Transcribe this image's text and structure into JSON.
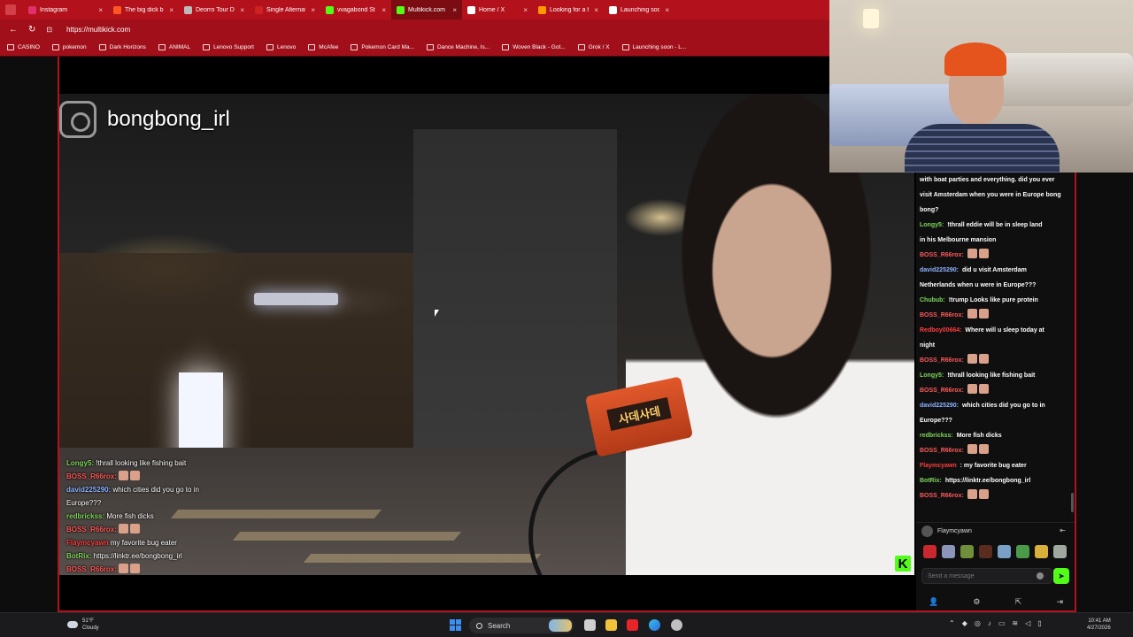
{
  "browser": {
    "tabs": [
      {
        "label": "Instagram",
        "color": "#e1306c",
        "active": false
      },
      {
        "label": "The big dick b",
        "color": "#ff5722",
        "active": false
      },
      {
        "label": "Deorro Tour Dates",
        "color": "#bbbbbb",
        "active": false
      },
      {
        "label": "Single Alternative",
        "color": "#cc2222",
        "active": false
      },
      {
        "label": "vvagabond St",
        "color": "#53fc18",
        "active": false
      },
      {
        "label": "Multikick.com",
        "color": "#53fc18",
        "active": true
      },
      {
        "label": "Home / X",
        "color": "#ffffff",
        "active": false
      },
      {
        "label": "Looking for a hous",
        "color": "#ff9800",
        "active": false
      },
      {
        "label": "Launching soon - L",
        "color": "#ffffff",
        "active": false
      }
    ],
    "url": "https://multikick.com",
    "bookmarks": [
      "CASINO",
      "pokemon",
      "Dark Horizons",
      "ANIMAL",
      "Lenovo Support",
      "Lenovo",
      "McAfee",
      "Pokemon Card Ma...",
      "Dance Machine, Is...",
      "Woven Black - Got...",
      "Grok / X",
      "Launching soon - L..."
    ]
  },
  "stream": {
    "channel_name": "bongbong_irl",
    "can_label": "사데사데",
    "overlay_chat": [
      {
        "user": "Longy5:",
        "user_color": "#7fd65a",
        "text": "!thrall looking like fishing bait"
      },
      {
        "user": "BOSS_R66rox:",
        "user_color": "#ff5a5a",
        "text": ""
      },
      {
        "user": "david225290:",
        "user_color": "#8fb3ff",
        "text": "which cities did you go to in"
      },
      {
        "user": "",
        "user_color": "#ffffff",
        "text": "Europe???"
      },
      {
        "user": "redbrickss:",
        "user_color": "#7fd65a",
        "text": "More fish dicks"
      },
      {
        "user": "BOSS_R66rox:",
        "user_color": "#ff5a5a",
        "text": ""
      },
      {
        "user": "Flaymcyawn",
        "user_color": "#ff3d3d",
        "text": "my favorite bug eater"
      },
      {
        "user": "BotRix:",
        "user_color": "#7fd65a",
        "text": "https://linktr.ee/bongbong_irl"
      },
      {
        "user": "BOSS_R66rox:",
        "user_color": "#ff5a5a",
        "text": ""
      }
    ],
    "kick_badge": "K"
  },
  "chat": {
    "messages": [
      {
        "user": "",
        "user_color": "#ffffff",
        "text": "with boat parties and everything. did you ever"
      },
      {
        "user": "",
        "user_color": "#ffffff",
        "text": "visit Amsterdam when you were in Europe bong"
      },
      {
        "user": "",
        "user_color": "#ffffff",
        "text": "bong?"
      },
      {
        "user": "Longy5:",
        "user_color": "#7fd65a",
        "text": "!thrall eddie will be in sleep land"
      },
      {
        "user": "",
        "user_color": "#ffffff",
        "text": "in his Melbourne mansion"
      },
      {
        "user": "BOSS_R66rox:",
        "user_color": "#ff5a5a",
        "text": ""
      },
      {
        "user": "david225290:",
        "user_color": "#8fb3ff",
        "text": "did u visit Amsterdam"
      },
      {
        "user": "",
        "user_color": "#ffffff",
        "text": "Netherlands when u were in Europe???"
      },
      {
        "user": "Chubub:",
        "user_color": "#7fd65a",
        "text": "!trump Looks like pure protein"
      },
      {
        "user": "BOSS_R66rox:",
        "user_color": "#ff5a5a",
        "text": ""
      },
      {
        "user": "Redboy00664:",
        "user_color": "#ff3d3d",
        "text": "Where will u sleep today at"
      },
      {
        "user": "",
        "user_color": "#ffffff",
        "text": "night"
      },
      {
        "user": "BOSS_R66rox:",
        "user_color": "#ff5a5a",
        "text": ""
      },
      {
        "user": "Longy5:",
        "user_color": "#7fd65a",
        "text": "!thrall looking like fishing bait"
      },
      {
        "user": "",
        "user_color": "#ffffff",
        "text": ""
      },
      {
        "user": "BOSS_R66rox:",
        "user_color": "#ff5a5a",
        "text": ""
      },
      {
        "user": "david225290:",
        "user_color": "#8fb3ff",
        "text": "which cities did you go to in"
      },
      {
        "user": "",
        "user_color": "#ffffff",
        "text": "Europe???"
      },
      {
        "user": "redbrickss:",
        "user_color": "#7fd65a",
        "text": "More fish dicks"
      },
      {
        "user": "BOSS_R66rox:",
        "user_color": "#ff5a5a",
        "text": ""
      },
      {
        "user": "Flaymcyawn",
        "user_color": "#ff3d3d",
        "text": ": my favorite bug eater"
      },
      {
        "user": "BotRix:",
        "user_color": "#7fd65a",
        "text": "https://linktr.ee/bongbong_irl"
      },
      {
        "user": "BOSS_R66rox:",
        "user_color": "#ff5a5a",
        "text": ""
      }
    ],
    "current_user": "Flaymcyawn",
    "input_placeholder": "Send a message",
    "accent": "#53fc18"
  },
  "taskbar": {
    "temperature": "51°F",
    "weather": "Cloudy",
    "search_label": "Search",
    "time": "10:41 AM",
    "date": "4/27/2026"
  }
}
